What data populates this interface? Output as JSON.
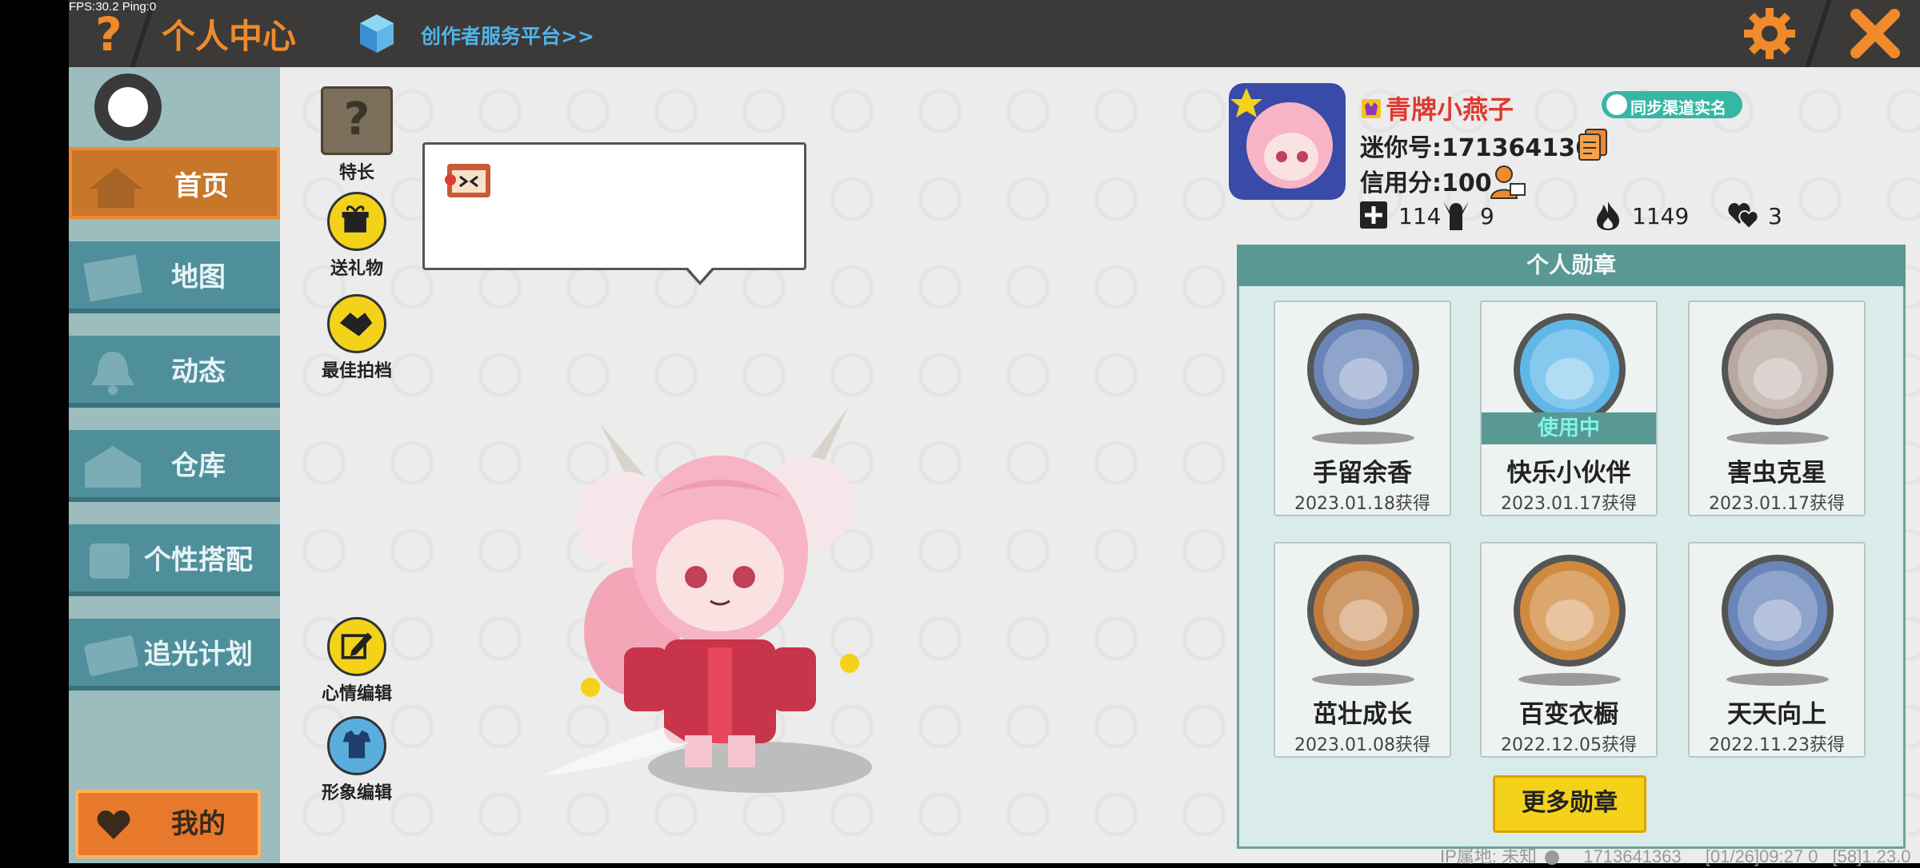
{
  "overlay": {
    "fps": "FPS:30.2  Ping:0"
  },
  "header": {
    "help_glyph": "?",
    "title": "个人中心",
    "creator_link": "创作者服务平台>>"
  },
  "sidebar": {
    "items": [
      {
        "label": "首页",
        "active": true
      },
      {
        "label": "地图"
      },
      {
        "label": "动态"
      },
      {
        "label": "仓库"
      },
      {
        "label": "个性搭配"
      },
      {
        "label": "追光计划"
      }
    ],
    "mine_label": "我的"
  },
  "tools": {
    "specialty": "特长",
    "gift": "送礼物",
    "best_photo": "最佳拍档",
    "mood_edit": "心情编辑",
    "avatar_edit": "形象编辑"
  },
  "profile": {
    "username": "青牌小燕子",
    "sync_label": "同步渠道实名",
    "mini_id": "迷你号:1713641363",
    "credit": "信用分:100",
    "stats": {
      "follows": "114",
      "fans": "9",
      "popularity": "1149",
      "likes": "3"
    }
  },
  "medals": {
    "header": "个人勋章",
    "in_use_label": "使用中",
    "items": [
      {
        "name": "手留余香",
        "date": "2023.01.18获得",
        "color": "#6a86b8"
      },
      {
        "name": "快乐小伙伴",
        "date": "2023.01.17获得",
        "color": "#5fb7e8",
        "in_use": true
      },
      {
        "name": "害虫克星",
        "date": "2023.01.17获得",
        "color": "#b8a8a0"
      },
      {
        "name": "茁壮成长",
        "date": "2023.01.08获得",
        "color": "#c07a3a"
      },
      {
        "name": "百变衣橱",
        "date": "2022.12.05获得",
        "color": "#d08a3e"
      },
      {
        "name": "天天向上",
        "date": "2022.11.23获得",
        "color": "#6a86b8"
      }
    ],
    "more_label": "更多勋章"
  },
  "footer": {
    "ip_text": "IP属地: 未知",
    "id_text": "1713641363",
    "time_text": "[01/26]09:27 0",
    "version_text": "[58]1.23.0"
  },
  "colors": {
    "accent_orange": "#f08a2a",
    "nav_teal": "#4f8f9b",
    "username_red": "#e03a30",
    "link_blue": "#4fb4e8"
  }
}
